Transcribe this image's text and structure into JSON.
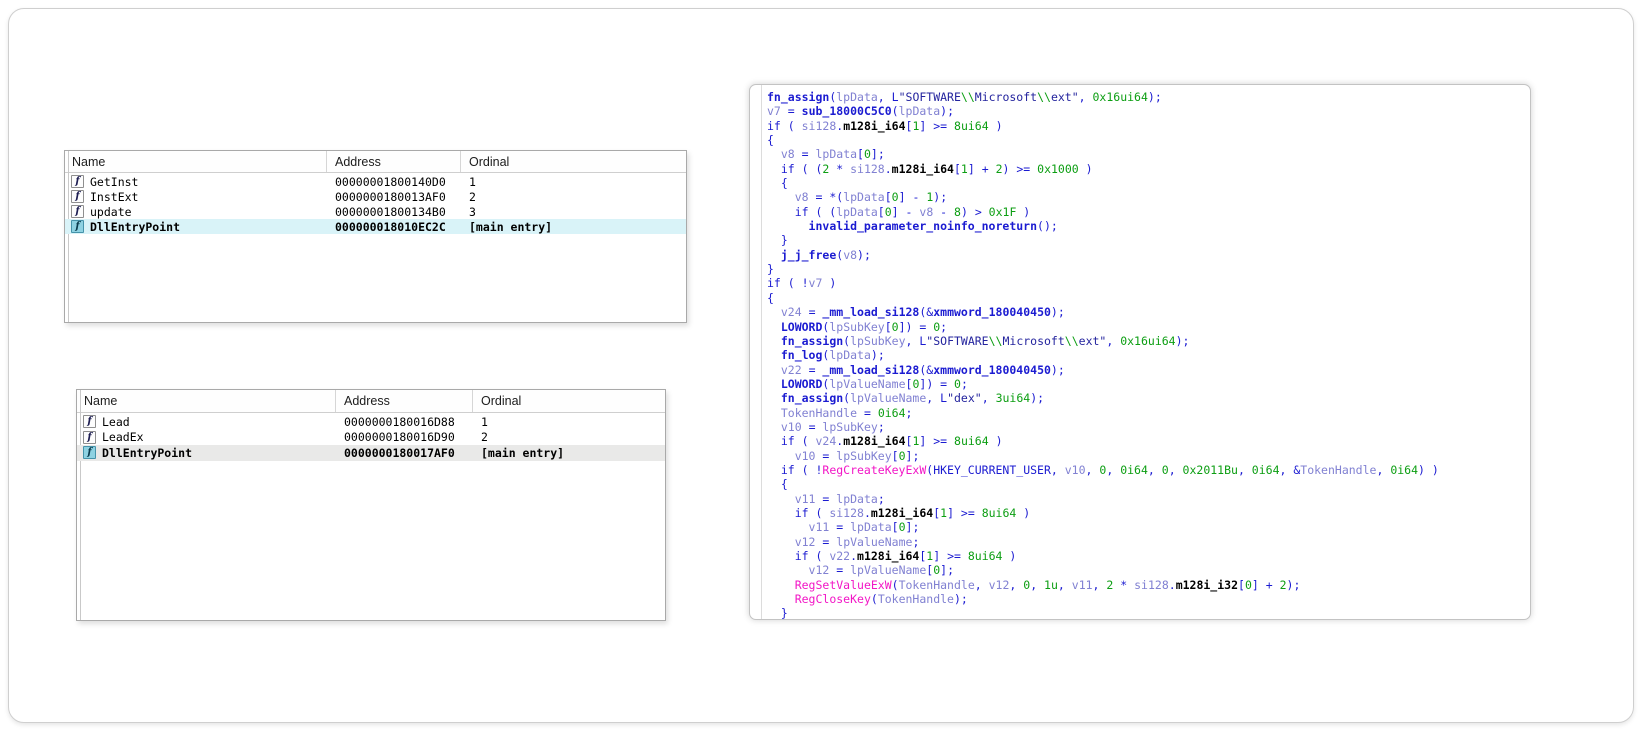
{
  "panels": {
    "exports1": {
      "columns": [
        "Name",
        "Address",
        "Ordinal"
      ],
      "selection_color": "#d9f3f8",
      "rows": [
        {
          "name": "GetInst",
          "address": "00000001800140D0",
          "ordinal": "1",
          "selected": false
        },
        {
          "name": "InstExt",
          "address": "0000000180013AF0",
          "ordinal": "2",
          "selected": false
        },
        {
          "name": "update",
          "address": "00000001800134B0",
          "ordinal": "3",
          "selected": false
        },
        {
          "name": "DllEntryPoint",
          "address": "000000018010EC2C",
          "ordinal": "[main entry]",
          "selected": true
        }
      ]
    },
    "exports2": {
      "columns": [
        "Name",
        "Address",
        "Ordinal"
      ],
      "selection_color": "#e9e9e8",
      "rows": [
        {
          "name": "Lead",
          "address": "0000000180016D88",
          "ordinal": "1",
          "selected": false
        },
        {
          "name": "LeadEx",
          "address": "0000000180016D90",
          "ordinal": "2",
          "selected": false
        },
        {
          "name": "DllEntryPoint",
          "address": "0000000180017AF0",
          "ordinal": "[main entry]",
          "selected": true
        }
      ]
    }
  },
  "icons": {
    "function_label": "f"
  },
  "code": {
    "styles": {
      "d": {
        "color": "#1b1bd1"
      },
      "v": {
        "color": "#8181d2"
      },
      "n": {
        "color": "#0c9e12"
      },
      "s": {
        "color": "#24249e"
      },
      "e": {
        "color": "#0c9e12"
      },
      "i": {
        "color": "#f216c6"
      },
      "f": {
        "color": "#1b1bd1",
        "bold": true
      },
      "m": {
        "color": "#000000",
        "bold": true
      }
    },
    "lines": [
      [
        [
          "fn_assign",
          "f"
        ],
        [
          "(",
          "d"
        ],
        [
          "lpData",
          "v"
        ],
        [
          ", ",
          "d"
        ],
        [
          "L",
          "d"
        ],
        [
          "\"SOFTWARE",
          "s"
        ],
        [
          "\\\\",
          "e"
        ],
        [
          "Microsoft",
          "s"
        ],
        [
          "\\\\",
          "e"
        ],
        [
          "ext\"",
          "s"
        ],
        [
          ", ",
          "d"
        ],
        [
          "0x16ui64",
          "n"
        ],
        [
          ");",
          "d"
        ]
      ],
      [
        [
          "v7",
          "v"
        ],
        [
          " = ",
          "d"
        ],
        [
          "sub_18000C5C0",
          "f"
        ],
        [
          "(",
          "d"
        ],
        [
          "lpData",
          "v"
        ],
        [
          ");",
          "d"
        ]
      ],
      [
        [
          "if ( ",
          "d"
        ],
        [
          "si128",
          "v"
        ],
        [
          ".",
          "d"
        ],
        [
          "m128i_i64",
          "m"
        ],
        [
          "[",
          "d"
        ],
        [
          "1",
          "n"
        ],
        [
          "]",
          "d"
        ],
        [
          " >= ",
          "d"
        ],
        [
          "8ui64",
          "n"
        ],
        [
          " )",
          "d"
        ]
      ],
      [
        [
          "{",
          "d"
        ]
      ],
      [
        [
          "  ",
          "d"
        ],
        [
          "v8",
          "v"
        ],
        [
          " = ",
          "d"
        ],
        [
          "lpData",
          "v"
        ],
        [
          "[",
          "d"
        ],
        [
          "0",
          "n"
        ],
        [
          "];",
          "d"
        ]
      ],
      [
        [
          "  if ( (",
          "d"
        ],
        [
          "2",
          "n"
        ],
        [
          " * ",
          "d"
        ],
        [
          "si128",
          "v"
        ],
        [
          ".",
          "d"
        ],
        [
          "m128i_i64",
          "m"
        ],
        [
          "[",
          "d"
        ],
        [
          "1",
          "n"
        ],
        [
          "]",
          "d"
        ],
        [
          " + ",
          "d"
        ],
        [
          "2",
          "n"
        ],
        [
          ") >= ",
          "d"
        ],
        [
          "0x1000",
          "n"
        ],
        [
          " )",
          "d"
        ]
      ],
      [
        [
          "  {",
          "d"
        ]
      ],
      [
        [
          "    ",
          "d"
        ],
        [
          "v8",
          "v"
        ],
        [
          " = *(",
          "d"
        ],
        [
          "lpData",
          "v"
        ],
        [
          "[",
          "d"
        ],
        [
          "0",
          "n"
        ],
        [
          "]",
          "d"
        ],
        [
          " - ",
          "d"
        ],
        [
          "1",
          "n"
        ],
        [
          ");",
          "d"
        ]
      ],
      [
        [
          "    if ( (",
          "d"
        ],
        [
          "lpData",
          "v"
        ],
        [
          "[",
          "d"
        ],
        [
          "0",
          "n"
        ],
        [
          "]",
          "d"
        ],
        [
          " - ",
          "d"
        ],
        [
          "v8",
          "v"
        ],
        [
          " - ",
          "d"
        ],
        [
          "8",
          "n"
        ],
        [
          ") > ",
          "d"
        ],
        [
          "0x1F",
          "n"
        ],
        [
          " )",
          "d"
        ]
      ],
      [
        [
          "      ",
          "d"
        ],
        [
          "invalid_parameter_noinfo_noreturn",
          "f"
        ],
        [
          "();",
          "d"
        ]
      ],
      [
        [
          "  }",
          "d"
        ]
      ],
      [
        [
          "  ",
          "d"
        ],
        [
          "j_j_free",
          "f"
        ],
        [
          "(",
          "d"
        ],
        [
          "v8",
          "v"
        ],
        [
          ");",
          "d"
        ]
      ],
      [
        [
          "}",
          "d"
        ]
      ],
      [
        [
          "if ( !",
          "d"
        ],
        [
          "v7",
          "v"
        ],
        [
          " )",
          "d"
        ]
      ],
      [
        [
          "{",
          "d"
        ]
      ],
      [
        [
          "  ",
          "d"
        ],
        [
          "v24",
          "v"
        ],
        [
          " = ",
          "d"
        ],
        [
          "_mm_load_si128",
          "f"
        ],
        [
          "(&",
          "d"
        ],
        [
          "xmmword_180040450",
          "f"
        ],
        [
          ");",
          "d"
        ]
      ],
      [
        [
          "  ",
          "d"
        ],
        [
          "LOWORD",
          "f"
        ],
        [
          "(",
          "d"
        ],
        [
          "lpSubKey",
          "v"
        ],
        [
          "[",
          "d"
        ],
        [
          "0",
          "n"
        ],
        [
          "]) = ",
          "d"
        ],
        [
          "0",
          "n"
        ],
        [
          ";",
          "d"
        ]
      ],
      [
        [
          "  ",
          "d"
        ],
        [
          "fn_assign",
          "f"
        ],
        [
          "(",
          "d"
        ],
        [
          "lpSubKey",
          "v"
        ],
        [
          ", ",
          "d"
        ],
        [
          "L",
          "d"
        ],
        [
          "\"SOFTWARE",
          "s"
        ],
        [
          "\\\\",
          "e"
        ],
        [
          "Microsoft",
          "s"
        ],
        [
          "\\\\",
          "e"
        ],
        [
          "ext\"",
          "s"
        ],
        [
          ", ",
          "d"
        ],
        [
          "0x16ui64",
          "n"
        ],
        [
          ");",
          "d"
        ]
      ],
      [
        [
          "  ",
          "d"
        ],
        [
          "fn_log",
          "f"
        ],
        [
          "(",
          "d"
        ],
        [
          "lpData",
          "v"
        ],
        [
          ");",
          "d"
        ]
      ],
      [
        [
          "  ",
          "d"
        ],
        [
          "v22",
          "v"
        ],
        [
          " = ",
          "d"
        ],
        [
          "_mm_load_si128",
          "f"
        ],
        [
          "(&",
          "d"
        ],
        [
          "xmmword_180040450",
          "f"
        ],
        [
          ");",
          "d"
        ]
      ],
      [
        [
          "  ",
          "d"
        ],
        [
          "LOWORD",
          "f"
        ],
        [
          "(",
          "d"
        ],
        [
          "lpValueName",
          "v"
        ],
        [
          "[",
          "d"
        ],
        [
          "0",
          "n"
        ],
        [
          "]) = ",
          "d"
        ],
        [
          "0",
          "n"
        ],
        [
          ";",
          "d"
        ]
      ],
      [
        [
          "  ",
          "d"
        ],
        [
          "fn_assign",
          "f"
        ],
        [
          "(",
          "d"
        ],
        [
          "lpValueName",
          "v"
        ],
        [
          ", ",
          "d"
        ],
        [
          "L",
          "d"
        ],
        [
          "\"dex\"",
          "s"
        ],
        [
          ", ",
          "d"
        ],
        [
          "3ui64",
          "n"
        ],
        [
          ");",
          "d"
        ]
      ],
      [
        [
          "  ",
          "d"
        ],
        [
          "TokenHandle",
          "v"
        ],
        [
          " = ",
          "d"
        ],
        [
          "0i64",
          "n"
        ],
        [
          ";",
          "d"
        ]
      ],
      [
        [
          "  ",
          "d"
        ],
        [
          "v10",
          "v"
        ],
        [
          " = ",
          "d"
        ],
        [
          "lpSubKey",
          "v"
        ],
        [
          ";",
          "d"
        ]
      ],
      [
        [
          "  if ( ",
          "d"
        ],
        [
          "v24",
          "v"
        ],
        [
          ".",
          "d"
        ],
        [
          "m128i_i64",
          "m"
        ],
        [
          "[",
          "d"
        ],
        [
          "1",
          "n"
        ],
        [
          "]",
          "d"
        ],
        [
          " >= ",
          "d"
        ],
        [
          "8ui64",
          "n"
        ],
        [
          " )",
          "d"
        ]
      ],
      [
        [
          "    ",
          "d"
        ],
        [
          "v10",
          "v"
        ],
        [
          " = ",
          "d"
        ],
        [
          "lpSubKey",
          "v"
        ],
        [
          "[",
          "d"
        ],
        [
          "0",
          "n"
        ],
        [
          "];",
          "d"
        ]
      ],
      [
        [
          "  if ( !",
          "d"
        ],
        [
          "RegCreateKeyExW",
          "i"
        ],
        [
          "(",
          "d"
        ],
        [
          "HKEY_CURRENT_USER",
          "d"
        ],
        [
          ", ",
          "d"
        ],
        [
          "v10",
          "v"
        ],
        [
          ", ",
          "d"
        ],
        [
          "0",
          "n"
        ],
        [
          ", ",
          "d"
        ],
        [
          "0i64",
          "n"
        ],
        [
          ", ",
          "d"
        ],
        [
          "0",
          "n"
        ],
        [
          ", ",
          "d"
        ],
        [
          "0x2011Bu",
          "n"
        ],
        [
          ", ",
          "d"
        ],
        [
          "0i64",
          "n"
        ],
        [
          ", &",
          "d"
        ],
        [
          "TokenHandle",
          "v"
        ],
        [
          ", ",
          "d"
        ],
        [
          "0i64",
          "n"
        ],
        [
          ") )",
          "d"
        ]
      ],
      [
        [
          "  {",
          "d"
        ]
      ],
      [
        [
          "    ",
          "d"
        ],
        [
          "v11",
          "v"
        ],
        [
          " = ",
          "d"
        ],
        [
          "lpData",
          "v"
        ],
        [
          ";",
          "d"
        ]
      ],
      [
        [
          "    if ( ",
          "d"
        ],
        [
          "si128",
          "v"
        ],
        [
          ".",
          "d"
        ],
        [
          "m128i_i64",
          "m"
        ],
        [
          "[",
          "d"
        ],
        [
          "1",
          "n"
        ],
        [
          "]",
          "d"
        ],
        [
          " >= ",
          "d"
        ],
        [
          "8ui64",
          "n"
        ],
        [
          " )",
          "d"
        ]
      ],
      [
        [
          "      ",
          "d"
        ],
        [
          "v11",
          "v"
        ],
        [
          " = ",
          "d"
        ],
        [
          "lpData",
          "v"
        ],
        [
          "[",
          "d"
        ],
        [
          "0",
          "n"
        ],
        [
          "];",
          "d"
        ]
      ],
      [
        [
          "    ",
          "d"
        ],
        [
          "v12",
          "v"
        ],
        [
          " = ",
          "d"
        ],
        [
          "lpValueName",
          "v"
        ],
        [
          ";",
          "d"
        ]
      ],
      [
        [
          "    if ( ",
          "d"
        ],
        [
          "v22",
          "v"
        ],
        [
          ".",
          "d"
        ],
        [
          "m128i_i64",
          "m"
        ],
        [
          "[",
          "d"
        ],
        [
          "1",
          "n"
        ],
        [
          "]",
          "d"
        ],
        [
          " >= ",
          "d"
        ],
        [
          "8ui64",
          "n"
        ],
        [
          " )",
          "d"
        ]
      ],
      [
        [
          "      ",
          "d"
        ],
        [
          "v12",
          "v"
        ],
        [
          " = ",
          "d"
        ],
        [
          "lpValueName",
          "v"
        ],
        [
          "[",
          "d"
        ],
        [
          "0",
          "n"
        ],
        [
          "];",
          "d"
        ]
      ],
      [
        [
          "    ",
          "d"
        ],
        [
          "RegSetValueExW",
          "i"
        ],
        [
          "(",
          "d"
        ],
        [
          "TokenHandle",
          "v"
        ],
        [
          ", ",
          "d"
        ],
        [
          "v12",
          "v"
        ],
        [
          ", ",
          "d"
        ],
        [
          "0",
          "n"
        ],
        [
          ", ",
          "d"
        ],
        [
          "1u",
          "n"
        ],
        [
          ", ",
          "d"
        ],
        [
          "v11",
          "v"
        ],
        [
          ", ",
          "d"
        ],
        [
          "2",
          "n"
        ],
        [
          " * ",
          "d"
        ],
        [
          "si128",
          "v"
        ],
        [
          ".",
          "d"
        ],
        [
          "m128i_i32",
          "m"
        ],
        [
          "[",
          "d"
        ],
        [
          "0",
          "n"
        ],
        [
          "]",
          "d"
        ],
        [
          " + ",
          "d"
        ],
        [
          "2",
          "n"
        ],
        [
          ");",
          "d"
        ]
      ],
      [
        [
          "    ",
          "d"
        ],
        [
          "RegCloseKey",
          "i"
        ],
        [
          "(",
          "d"
        ],
        [
          "TokenHandle",
          "v"
        ],
        [
          ");",
          "d"
        ]
      ],
      [
        [
          "  }",
          "d"
        ]
      ]
    ]
  }
}
